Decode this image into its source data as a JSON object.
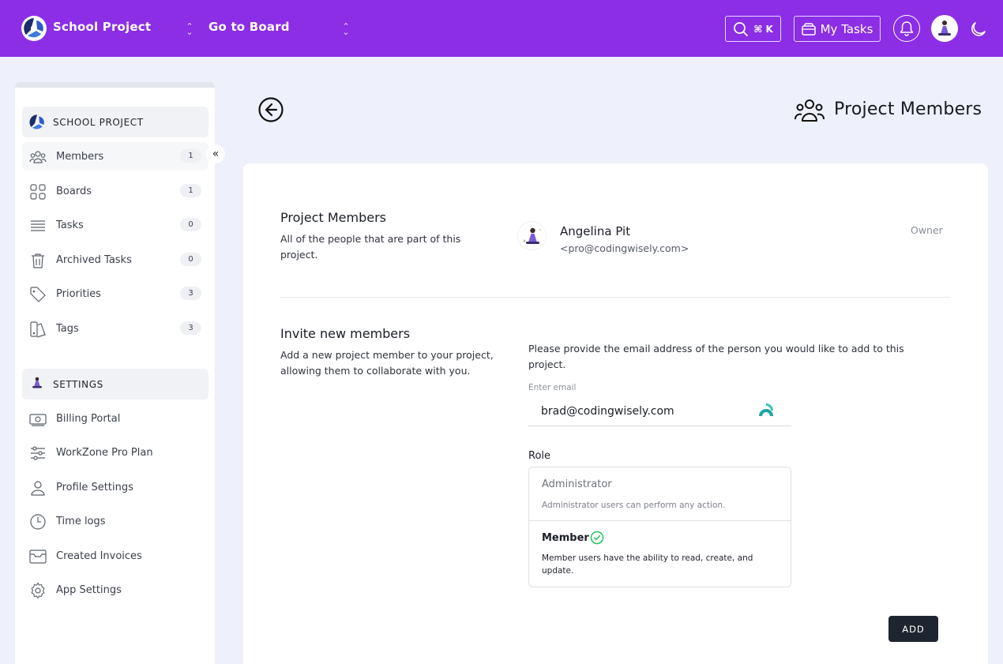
{
  "topbar": {
    "project_name": "School Project",
    "board_select": "Go to Board",
    "search_shortcut": "⌘ K",
    "my_tasks_label": "My Tasks",
    "icons": [
      "logo-icon",
      "search-icon",
      "inbox-icon",
      "bell-icon",
      "moon-icon"
    ],
    "accent": "#8b2ee6"
  },
  "sidebar": {
    "project_header": "SCHOOL PROJECT",
    "settings_header": "SETTINGS",
    "project_items": [
      {
        "label": "Members",
        "count": "1",
        "icon": "users-icon"
      },
      {
        "label": "Boards",
        "count": "1",
        "icon": "boards-icon"
      },
      {
        "label": "Tasks",
        "count": "0",
        "icon": "list-icon"
      },
      {
        "label": "Archived Tasks",
        "count": "0",
        "icon": "trash-icon"
      },
      {
        "label": "Priorities",
        "count": "3",
        "icon": "tag-icon"
      },
      {
        "label": "Tags",
        "count": "3",
        "icon": "tags-icon"
      }
    ],
    "settings_items": [
      {
        "label": "Billing Portal",
        "icon": "billing-icon"
      },
      {
        "label": "WorkZone Pro Plan",
        "icon": "sliders-icon"
      },
      {
        "label": "Profile Settings",
        "icon": "user-icon"
      },
      {
        "label": "Time logs",
        "icon": "clock-icon"
      },
      {
        "label": "Created Invoices",
        "icon": "invoice-icon"
      },
      {
        "label": "App Settings",
        "icon": "gear-icon"
      }
    ]
  },
  "page": {
    "title": "Project Members"
  },
  "members_section": {
    "title": "Project Members",
    "description": "All of the people that are part of this project.",
    "member": {
      "name": "Angelina Pit",
      "email": "<pro@codingwisely.com>",
      "role": "Owner"
    }
  },
  "invite_section": {
    "title": "Invite new members",
    "description": "Add a new project member to your project, allowing them to collaborate with you.",
    "note": "Please provide the email address of the person you would like to add to this project.",
    "email_label": "Enter email",
    "email_value": "brad@codingwisely.com",
    "role_label": "Role",
    "roles": [
      {
        "name": "Administrator",
        "description": "Administrator users can perform any action.",
        "selected": false
      },
      {
        "name": "Member",
        "description": "Member users have the ability to read, create, and update.",
        "selected": true
      }
    ],
    "add_button": "ADD"
  }
}
